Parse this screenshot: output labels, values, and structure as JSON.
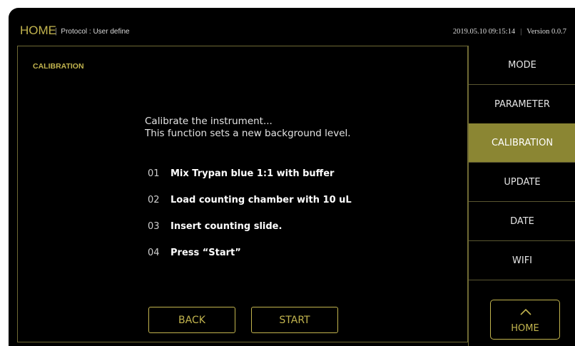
{
  "header": {
    "home_title": "HOME",
    "separator": "|",
    "protocol": "Protocol : User define",
    "datetime": "2019.05.10 09:15:14",
    "version": "Version 0.0.7"
  },
  "panel": {
    "title": "CALIBRATION",
    "intro_line1": "Calibrate the instrument...",
    "intro_line2": "This function sets a new background level.",
    "steps": [
      {
        "num": "01",
        "text": "Mix Trypan blue 1:1 with buffer"
      },
      {
        "num": "02",
        "text": "Load counting chamber with 10 uL"
      },
      {
        "num": "03",
        "text": "Insert counting slide."
      },
      {
        "num": "04",
        "text": "Press “Start”"
      }
    ],
    "back_label": "BACK",
    "start_label": "START"
  },
  "sidebar": {
    "items": [
      {
        "label": "MODE"
      },
      {
        "label": "PARAMETER"
      },
      {
        "label": "CALIBRATION",
        "active": true
      },
      {
        "label": "UPDATE"
      },
      {
        "label": "DATE"
      },
      {
        "label": "WIFI"
      }
    ],
    "home_label": "HOME",
    "home_icon": "home-chevron-icon"
  },
  "colors": {
    "accent": "#c2b44e",
    "active_bg": "#8b8633",
    "background": "#000000"
  }
}
